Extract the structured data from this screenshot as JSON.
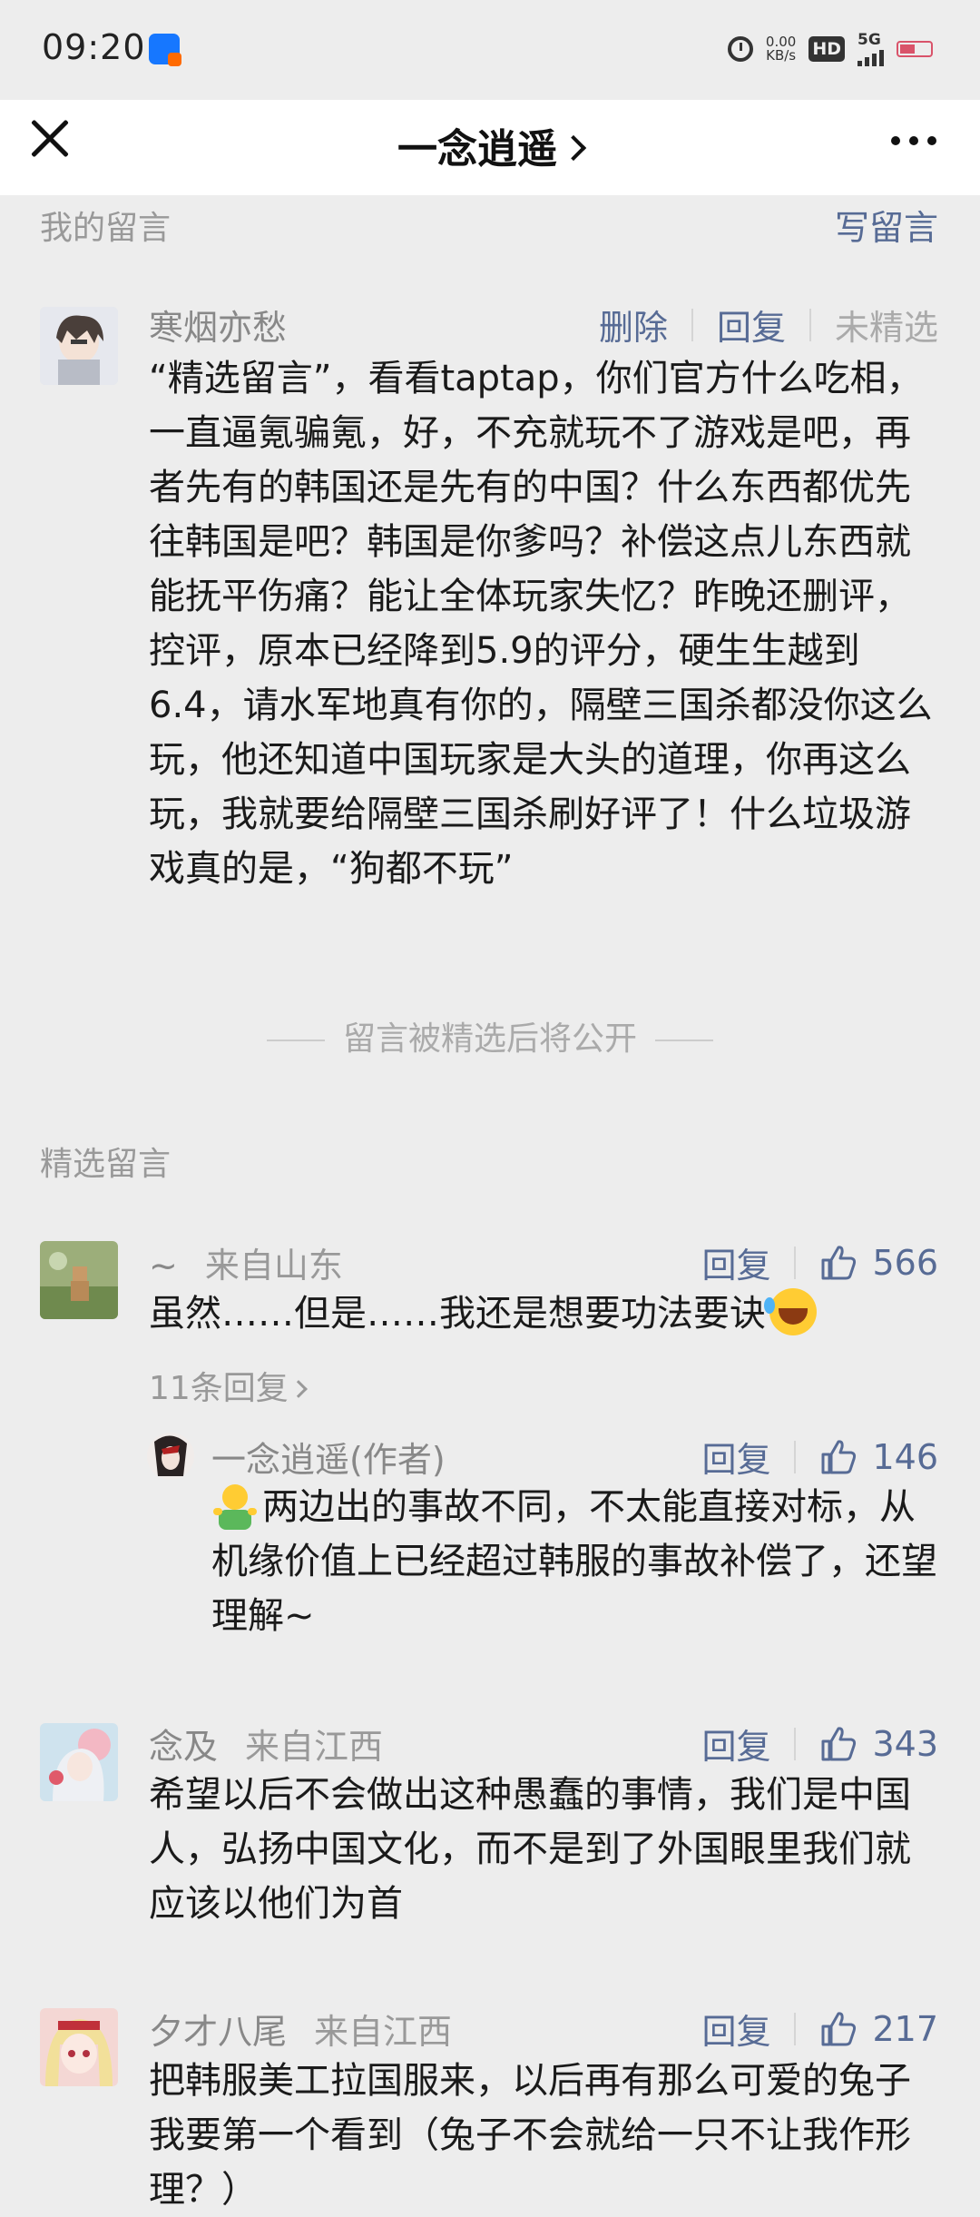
{
  "status_bar": {
    "time": "09:20",
    "net_speed_value": "0.00",
    "net_speed_unit": "KB/s",
    "hd_label": "HD",
    "network": "5G",
    "icons": [
      "alarm-icon",
      "hd-icon",
      "signal-icon",
      "battery-icon"
    ]
  },
  "header": {
    "title": "一念逍遥",
    "close_icon": "close-icon",
    "more_icon": "more-icon"
  },
  "my_comments": {
    "heading": "我的留言",
    "write_label": "写留言",
    "items": [
      {
        "name": "寒烟亦愁",
        "delete_label": "删除",
        "reply_label": "回复",
        "status_label": "未精选",
        "text": "“精选留言”，看看taptap，你们官方什么吃相，一直逼氪骗氪，好，不充就玩不了游戏是吧，再者先有的韩国还是先有的中国？什么东西都优先往韩国是吧？韩国是你爹吗？补偿这点儿东西就能抚平伤痛？能让全体玩家失忆？昨晚还删评，控评，原本已经降到5.9的评分，硬生生越到6.4，请水军地真有你的，隔壁三国杀都没你这么玩，他还知道中国玩家是大头的道理，你再这么玩，我就要给隔壁三国杀刷好评了！什么垃圾游戏真的是，“狗都不玩”"
      }
    ],
    "note": "留言被精选后将公开"
  },
  "featured": {
    "heading": "精选留言",
    "items": [
      {
        "name": "~",
        "location": "来自山东",
        "reply_label": "回复",
        "likes": "566",
        "text": "虽然……但是……我还是想要功法要诀",
        "replies_link": "11条回复",
        "author_reply": {
          "name": "一念逍遥(作者)",
          "reply_label": "回复",
          "likes": "146",
          "text": "两边出的事故不同，不太能直接对标，从机缘价值上已经超过韩服的事故补偿了，还望理解~"
        }
      },
      {
        "name": "念及",
        "location": "来自江西",
        "reply_label": "回复",
        "likes": "343",
        "text": "希望以后不会做出这种愚蠢的事情，我们是中国人，弘扬中国文化，而不是到了外国眼里我们就应该以他们为首"
      },
      {
        "name": "夕才八尾",
        "location": "来自江西",
        "reply_label": "回复",
        "likes": "217",
        "text": "把韩服美工拉国服来，以后再有那么可爱的兔子我要第一个看到（兔子不会就给一只不让我作形理？）"
      }
    ]
  }
}
